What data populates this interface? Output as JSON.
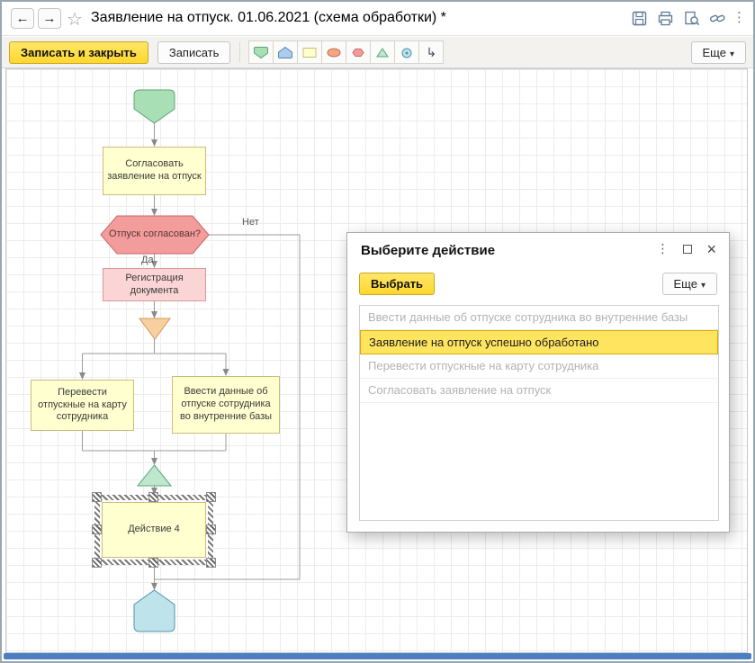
{
  "titlebar": {
    "title": "Заявление на отпуск. 01.06.2021 (схема обработки) *",
    "icons": {
      "back": "←",
      "forward": "→",
      "star": "☆",
      "kebab": "⋮"
    }
  },
  "toolbar": {
    "save_close_label": "Записать и закрыть",
    "save_label": "Записать",
    "more_label": "Еще",
    "more_caret": "▾",
    "connector_tool_glyph": "↳"
  },
  "scheme": {
    "nodes": {
      "approve": "Согласовать заявление на отпуск",
      "decision": "Отпуск согласован?",
      "register": "Регистрация документа",
      "transfer": "Перевести отпускные на карту сотрудника",
      "enter_data": "Ввести данные об отпуске сотрудника во внутренние базы",
      "action4": "Действие 4"
    },
    "branch_labels": {
      "yes": "Да",
      "no": "Нет"
    },
    "colors": {
      "start_fill": "#a9dfb5",
      "start_border": "#5ba473",
      "action_fill": "#ffffd0",
      "action_border": "#c9bc7a",
      "decision_fill": "#f29c9c",
      "decision_border": "#cc6666",
      "register_fill": "#fbd5d5",
      "register_border": "#d89898",
      "split_fill": "#f7cfa0",
      "split_border": "#cf9c55",
      "merge_fill": "#bfe6cf",
      "merge_border": "#57a87a",
      "end_fill": "#bfe3ea",
      "end_border": "#4e93a8",
      "selected_row_bg": "#ffe55f",
      "accent_yellow": "#ffd72e"
    }
  },
  "dialog": {
    "title": "Выберите действие",
    "select_label": "Выбрать",
    "more_label": "Еще",
    "more_caret": "▾",
    "controls": {
      "kebab": "⋮",
      "maximize": "",
      "close": "×"
    },
    "items": [
      {
        "label": "Ввести данные об отпуске сотрудника во внутренние базы",
        "state": "disabled"
      },
      {
        "label": "Заявление на отпуск успешно обработано",
        "state": "selected"
      },
      {
        "label": "Перевести отпускные на карту сотрудника",
        "state": "disabled"
      },
      {
        "label": "Согласовать заявление на отпуск",
        "state": "disabled"
      }
    ]
  }
}
